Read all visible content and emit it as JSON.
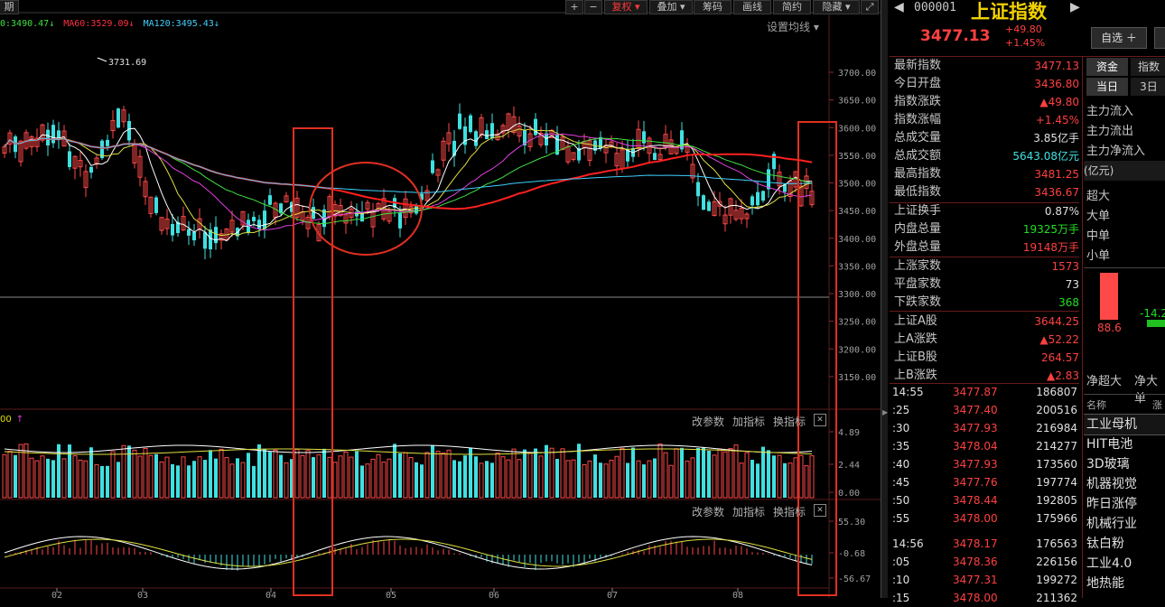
{
  "toolbar": {
    "period": "期",
    "plus": "+",
    "minus": "−",
    "fq": "复权 ▾",
    "overlay": "叠加 ▾",
    "chip": "筹码",
    "draw": "画线",
    "brief": "简约",
    "hide": "隐藏 ▾",
    "expand": "⤢"
  },
  "ma_line": {
    "ma_a": "0:3490.47",
    "ma_a_arrow": "↓",
    "ma60": "MA60:3529.09",
    "ma60_arrow": "↓",
    "ma120": "MA120:3495.43",
    "ma120_arrow": "↓"
  },
  "settings_ma": "设置均线 ▾",
  "price_axis": [
    "3700.00",
    "3650.00",
    "3600.00",
    "3550.00",
    "3500.00",
    "3450.00",
    "3400.00",
    "3350.00",
    "3300.00",
    "3250.00",
    "3200.00",
    "3150.00"
  ],
  "high_label": "3731.69",
  "vol_panel": {
    "label": "00",
    "arrow": "↑",
    "change_params": "改参数",
    "add_ind": "加指标",
    "switch_ind": "换指标",
    "close": "✕",
    "axis": [
      "4.89",
      "2.44",
      "0.00"
    ]
  },
  "macd_panel": {
    "change_params": "改参数",
    "add_ind": "加指标",
    "switch_ind": "换指标",
    "close": "✕",
    "axis": [
      "55.30",
      "-0.68",
      "-56.67"
    ]
  },
  "months": [
    "02",
    "03",
    "04",
    "05",
    "06",
    "07",
    "08"
  ],
  "header": {
    "code": "000001",
    "name": "上证指数",
    "price": "3477.13",
    "change": "+49.80",
    "change_pct": "+1.45%",
    "watch_button": "自选 ＋"
  },
  "quote_rows": [
    {
      "label": "最新指数",
      "value": "3477.13",
      "cls": "red"
    },
    {
      "label": "今日开盘",
      "value": "3436.80",
      "cls": "red"
    },
    {
      "label": "指数涨跌",
      "value": "▲49.80",
      "cls": "red"
    },
    {
      "label": "指数涨幅",
      "value": "+1.45%",
      "cls": "red"
    },
    {
      "label": "总成交量",
      "value": "3.85亿手",
      "cls": "wht"
    },
    {
      "label": "总成交额",
      "value": "5643.08亿元",
      "cls": "cyan"
    },
    {
      "label": "最高指数",
      "value": "3481.25",
      "cls": "red"
    },
    {
      "label": "最低指数",
      "value": "3436.67",
      "cls": "red"
    },
    {
      "label": "上证换手",
      "value": "0.87%",
      "cls": "wht"
    },
    {
      "label": "内盘总量",
      "value": "19325万手",
      "cls": "grn"
    },
    {
      "label": "外盘总量",
      "value": "19148万手",
      "cls": "red"
    },
    {
      "label": "上涨家数",
      "value": "1573",
      "cls": "red"
    },
    {
      "label": "平盘家数",
      "value": "73",
      "cls": "wht"
    },
    {
      "label": "下跌家数",
      "value": "368",
      "cls": "grn"
    },
    {
      "label": "上证A股",
      "value": "3644.25",
      "cls": "red"
    },
    {
      "label": "上A涨跌",
      "value": "▲52.22",
      "cls": "red"
    },
    {
      "label": "上证B股",
      "value": "264.57",
      "cls": "red"
    },
    {
      "label": "上B涨跌",
      "value": "▲2.83",
      "cls": "red"
    }
  ],
  "ticks": [
    {
      "t": "14:55",
      "p": "3477.87",
      "v": "186807"
    },
    {
      "t": ":25",
      "p": "3477.40",
      "v": "200516"
    },
    {
      "t": ":30",
      "p": "3477.93",
      "v": "216984"
    },
    {
      "t": ":35",
      "p": "3478.04",
      "v": "214277"
    },
    {
      "t": ":40",
      "p": "3477.93",
      "v": "173560"
    },
    {
      "t": ":45",
      "p": "3477.76",
      "v": "197774"
    },
    {
      "t": ":50",
      "p": "3478.44",
      "v": "192805"
    },
    {
      "t": ":55",
      "p": "3478.00",
      "v": "175966"
    },
    {
      "t": "14:56",
      "p": "3478.17",
      "v": "176563"
    },
    {
      "t": ":05",
      "p": "3478.36",
      "v": "226156"
    },
    {
      "t": ":10",
      "p": "3477.31",
      "v": "199272"
    },
    {
      "t": ":15",
      "p": "3478.00",
      "v": "211362"
    }
  ],
  "fund": {
    "tab1": "资金",
    "tab2": "指数",
    "tab3": "当日",
    "tab4": "3日",
    "inflow": "主力流入",
    "outflow": "主力流出",
    "net": "主力净流入",
    "unit": "(亿元)",
    "sizes": [
      "超大",
      "大单",
      "中单",
      "小单"
    ],
    "bar1": "88.6",
    "bar2": "-14.2",
    "net_super": "净超大",
    "net_big": "净大单"
  },
  "sectors": {
    "col_name": "名称",
    "col_chg": "涨",
    "items": [
      "工业母机",
      "HIT电池",
      "3D玻璃",
      "机器视觉",
      "昨日涨停",
      "机械行业",
      "钛白粉",
      "工业4.0",
      "地热能"
    ]
  },
  "colors": {
    "up": "#ff4040",
    "down": "#40e0e0",
    "annotation": "#e03020",
    "bg": "#000000"
  }
}
